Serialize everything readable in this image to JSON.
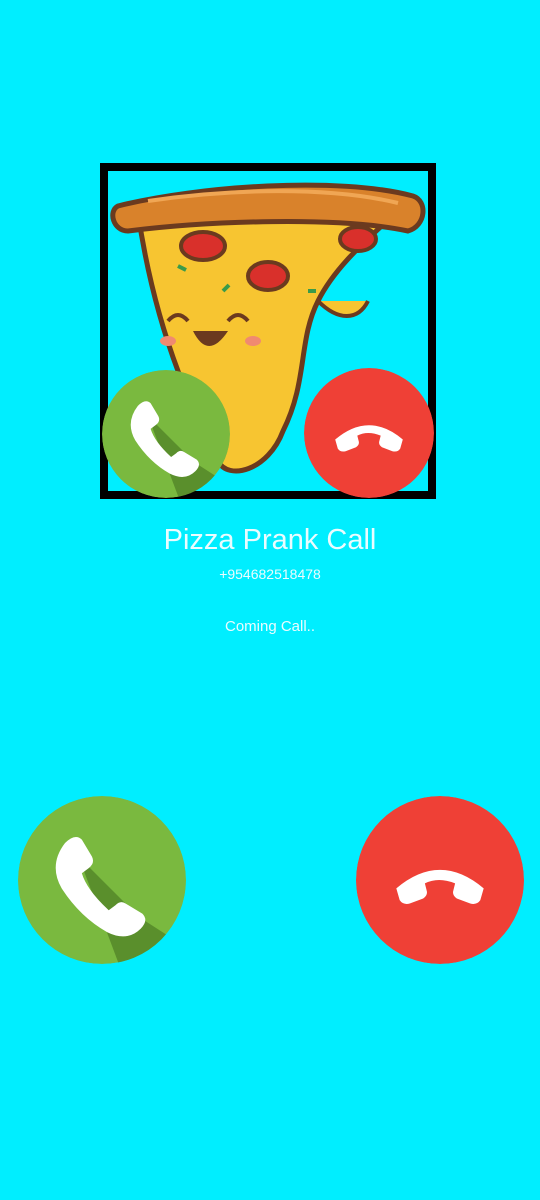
{
  "caller": {
    "name": "Pizza Prank Call",
    "number": "+954682518478",
    "status": "Coming Call.."
  },
  "avatar": {
    "icon": "pizza-mascot-icon"
  },
  "buttons": {
    "accept": {
      "icon": "phone-accept-icon",
      "color": "#7ab93f"
    },
    "decline": {
      "icon": "phone-decline-icon",
      "color": "#ef4036"
    }
  },
  "colors": {
    "background": "#00eeff"
  }
}
